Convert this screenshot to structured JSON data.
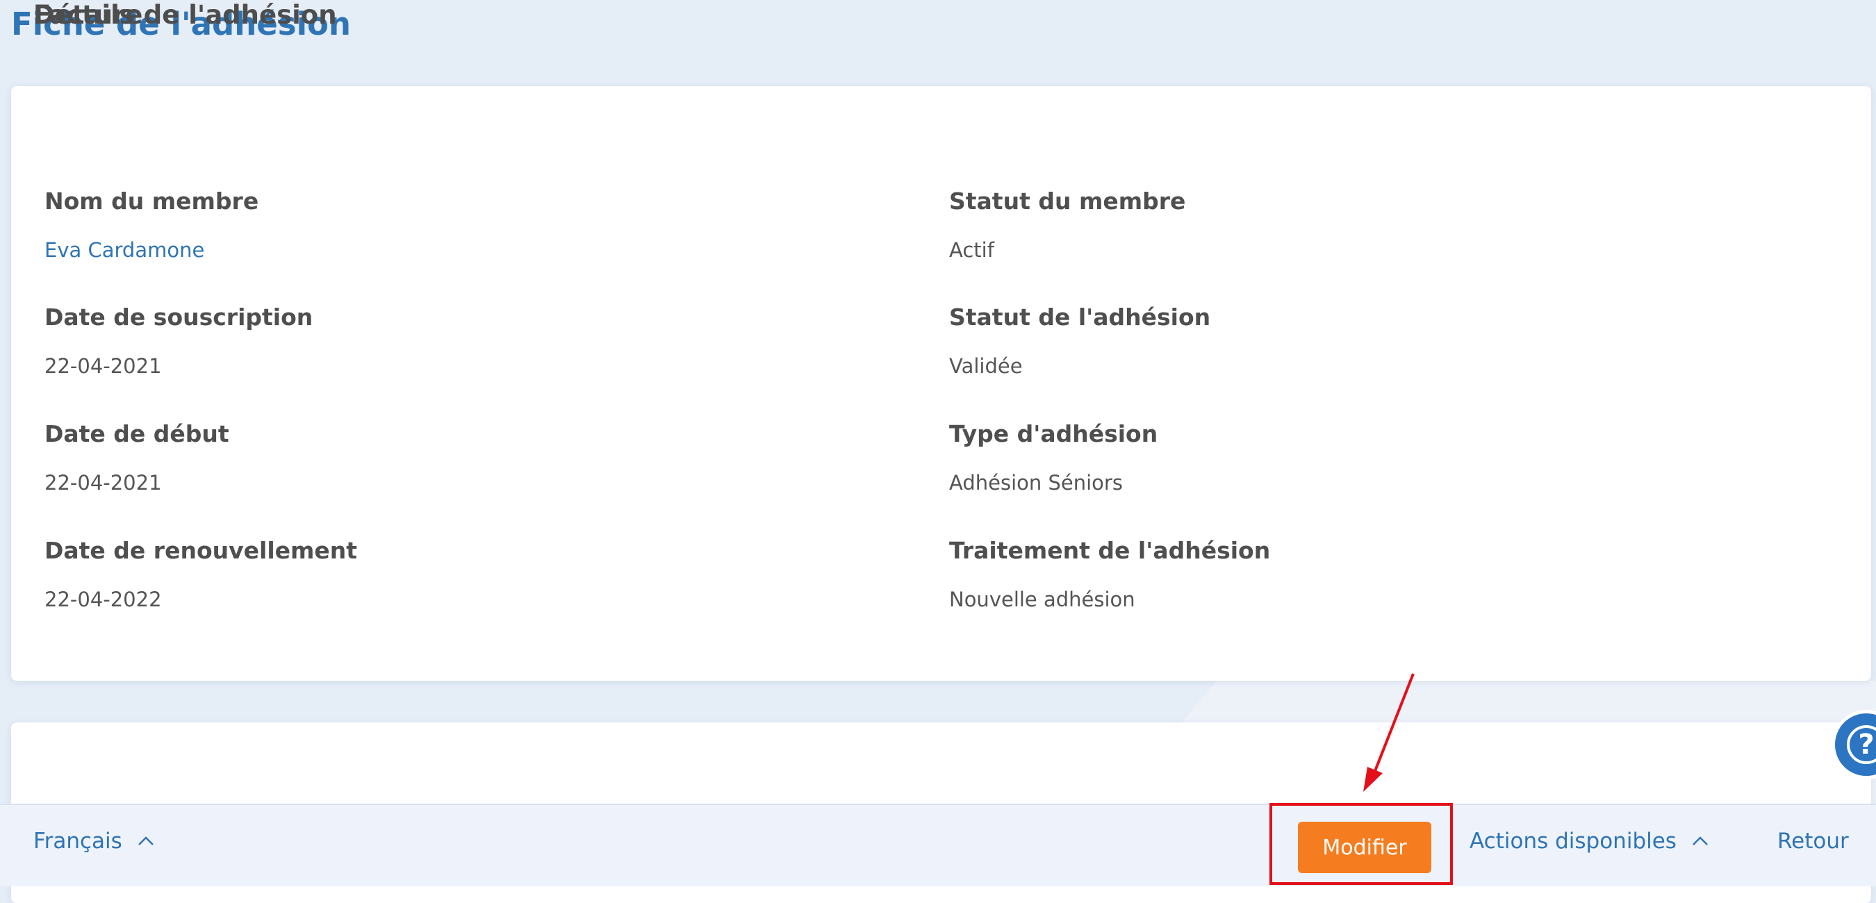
{
  "page": {
    "title": "Fiche de l'adhésion"
  },
  "details": {
    "title": "Détails de l'adhésion",
    "fields": [
      {
        "label": "Nom du membre",
        "value": "Eva Cardamone"
      },
      {
        "label": "Statut du membre",
        "value": "Actif"
      },
      {
        "label": "Date de souscription",
        "value": "22-04-2021"
      },
      {
        "label": "Statut de l'adhésion",
        "value": "Validée"
      },
      {
        "label": "Date de début",
        "value": "22-04-2021"
      },
      {
        "label": "Type d'adhésion",
        "value": "Adhésion Séniors"
      },
      {
        "label": "Date de renouvellement",
        "value": "22-04-2022"
      },
      {
        "label": "Traitement de l'adhésion",
        "value": "Nouvelle adhésion"
      }
    ]
  },
  "invoice": {
    "title": "Facture"
  },
  "help": {
    "glyph": "?",
    "icon": "help-circle-icon"
  },
  "bottom_bar": {
    "language": "Français",
    "modify": "Modifier",
    "actions": "Actions disponibles",
    "back": "Retour"
  },
  "colors": {
    "accent": "#2f74b5",
    "primary_button": "#f57c1f",
    "annotation": "#e3101b",
    "background": "#e5edf7"
  }
}
